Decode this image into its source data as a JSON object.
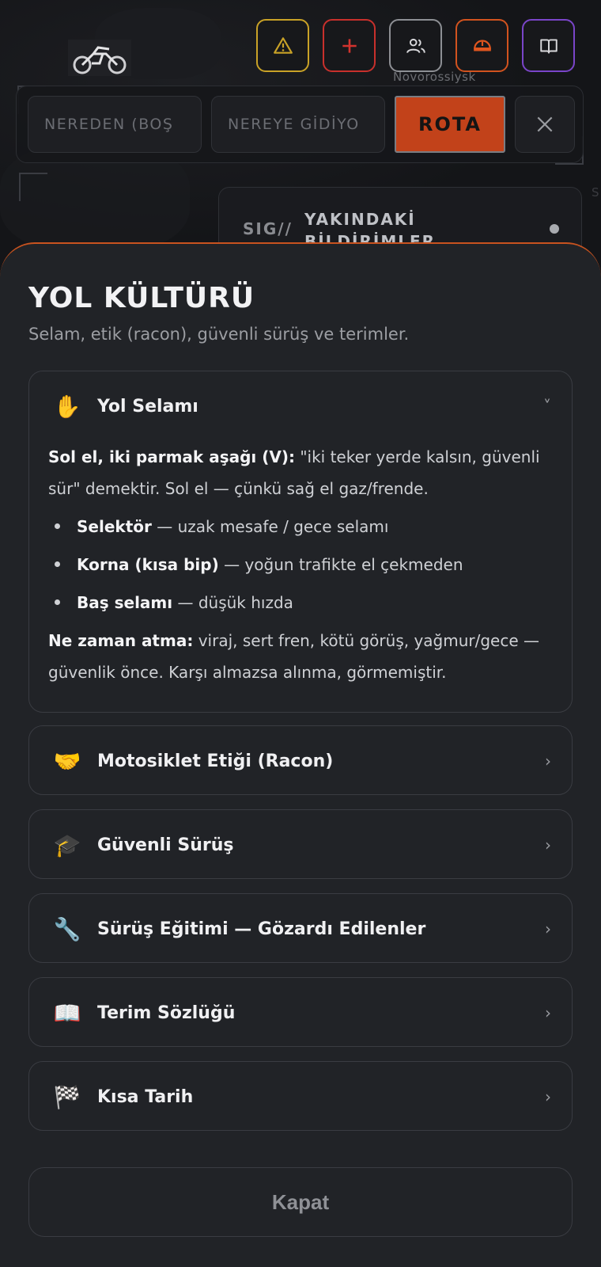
{
  "map": {
    "city_label": "Novorossiysk",
    "edge_label": "S"
  },
  "toolbar": {
    "buttons": [
      {
        "name": "warning",
        "color": "#c9a227"
      },
      {
        "name": "add",
        "color": "#c8302c"
      },
      {
        "name": "group",
        "color": "#8d8f94"
      },
      {
        "name": "helmet",
        "color": "#d2531f"
      },
      {
        "name": "book",
        "color": "#7a45c9"
      }
    ]
  },
  "route": {
    "from_placeholder": "NEREDEN (BOŞ",
    "to_placeholder": "NEREYE GİDİYO",
    "go_label": "ROTA"
  },
  "alerts": {
    "prefix": "SIG//",
    "title": "YAKINDAKİ BİLDİRİMLER"
  },
  "sheet": {
    "title": "YOL KÜLTÜRÜ",
    "subtitle": "Selam, etik (racon), güvenli sürüş ve terimler.",
    "sections": [
      {
        "icon": "✋",
        "label": "Yol Selamı",
        "chevron": "˅",
        "expanded": true,
        "intro_bold": "Sol el, iki parmak aşağı (V):",
        "intro_text": " \"iki teker yerde kalsın, güvenli sür\" demektir. Sol el — çünkü sağ el gaz/frende.",
        "bullets": [
          {
            "bold": "Selektör",
            "text": " — uzak mesafe / gece selamı"
          },
          {
            "bold": "Korna (kısa bip)",
            "text": " — yoğun trafikte el çekmeden"
          },
          {
            "bold": "Baş selamı",
            "text": " — düşük hızda"
          }
        ],
        "outro_bold": "Ne zaman atma:",
        "outro_text": " viraj, sert fren, kötü görüş, yağmur/gece — güvenlik önce. Karşı almazsa alınma, görmemiştir."
      },
      {
        "icon": "🤝",
        "label": "Motosiklet Etiği (Racon)",
        "chevron": "›"
      },
      {
        "icon": "🎓",
        "label": "Güvenli Sürüş",
        "chevron": "›"
      },
      {
        "icon": "🔧",
        "label": "Sürüş Eğitimi — Gözardı Edilenler",
        "chevron": "›"
      },
      {
        "icon": "📖",
        "label": "Terim Sözlüğü",
        "chevron": "›"
      },
      {
        "icon": "🏁",
        "label": "Kısa Tarih",
        "chevron": "›"
      }
    ],
    "close_label": "Kapat"
  }
}
